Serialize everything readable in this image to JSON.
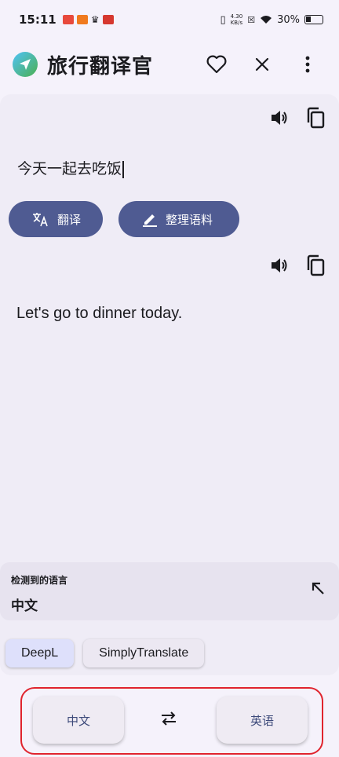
{
  "status_bar": {
    "time": "15:11",
    "net_speed_value": "4.30",
    "net_speed_unit": "KB/s",
    "battery": "30%"
  },
  "app": {
    "title": "旅行翻译官"
  },
  "input": {
    "text": "今天一起去吃饭"
  },
  "actions": {
    "translate_label": "翻译",
    "organize_label": "整理语料"
  },
  "output": {
    "text": "Let's go to dinner today."
  },
  "detected": {
    "label": "检测到的语言",
    "value": "中文"
  },
  "engines": [
    {
      "label": "DeepL",
      "selected": true
    },
    {
      "label": "SimplyTranslate",
      "selected": false
    }
  ],
  "languages": {
    "source": "中文",
    "target": "英语"
  },
  "colors": {
    "primary": "#4f5b92",
    "highlight_border": "#e0242e",
    "background": "#f5f2fb"
  }
}
